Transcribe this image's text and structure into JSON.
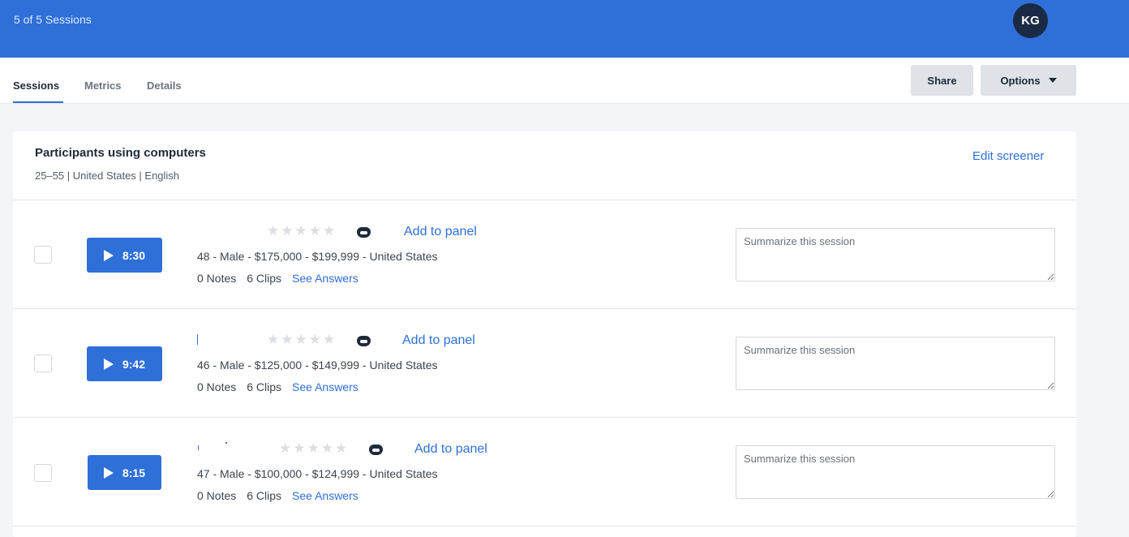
{
  "header": {
    "title": "5 of 5 Sessions",
    "avatar_initials": "KG"
  },
  "tabs": [
    {
      "label": "Sessions"
    },
    {
      "label": "Metrics"
    },
    {
      "label": "Details"
    }
  ],
  "toolbar": {
    "share_label": "Share",
    "options_label": "Options"
  },
  "screener": {
    "title": "Participants using computers",
    "subtitle": "25–55 | United States | English",
    "edit_label": "Edit screener"
  },
  "sessions": [
    {
      "duration": "8:30",
      "stars": "★★★★★",
      "add_label": "Add to panel",
      "demographics": "48 - Male - $175,000 - $199,999 - United States",
      "notes": "0 Notes",
      "clips": "6 Clips",
      "answers_label": "See Answers",
      "summary_placeholder": "Summarize this session",
      "rating": 0
    },
    {
      "duration": "9:42",
      "stars": "★★★★★",
      "add_label": "Add to panel",
      "demographics": "46 - Male - $125,000 - $149,999 - United States",
      "notes": "0 Notes",
      "clips": "6 Clips",
      "answers_label": "See Answers",
      "summary_placeholder": "Summarize this session",
      "rating": 0
    },
    {
      "duration": "8:15",
      "stars": "★★★★★",
      "add_label": "Add to panel",
      "demographics": "47 - Male - $100,000 - $124,999 - United States",
      "notes": "0 Notes",
      "clips": "6 Clips",
      "answers_label": "See Answers",
      "summary_placeholder": "Summarize this session",
      "rating": 0
    }
  ],
  "colors": {
    "brand": "#2f6fd8",
    "avatar_bg": "#1b2a44"
  }
}
